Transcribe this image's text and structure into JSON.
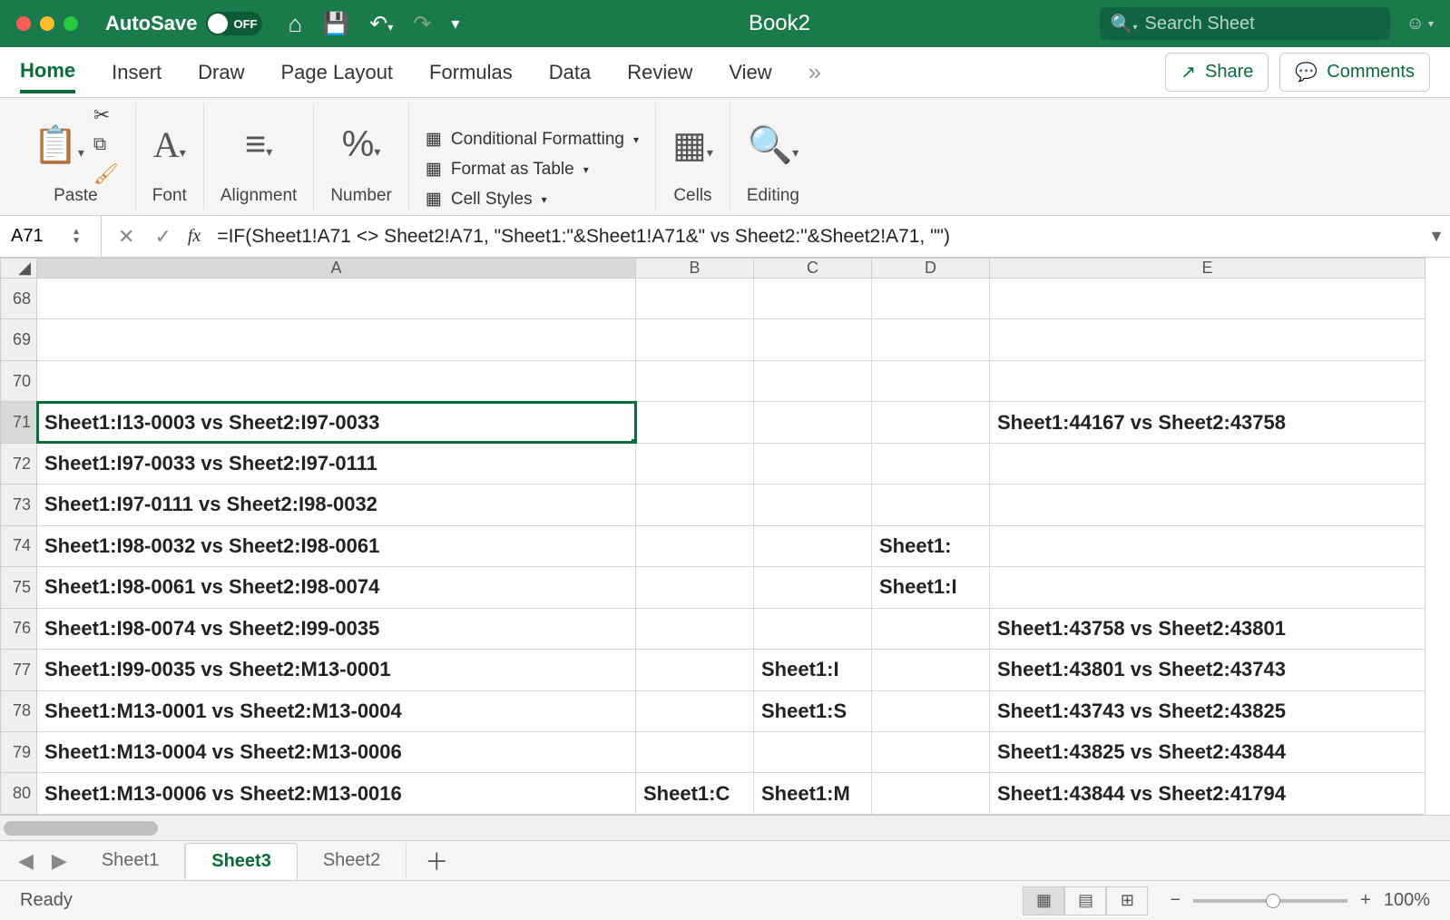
{
  "titlebar": {
    "autosave_label": "AutoSave",
    "autosave_state": "OFF",
    "doc_title": "Book2",
    "search_placeholder": "Search Sheet"
  },
  "ribbon_tabs": {
    "items": [
      "Home",
      "Insert",
      "Draw",
      "Page Layout",
      "Formulas",
      "Data",
      "Review",
      "View"
    ],
    "active": "Home",
    "share": "Share",
    "comments": "Comments"
  },
  "ribbon_groups": {
    "paste": "Paste",
    "font": "Font",
    "alignment": "Alignment",
    "number": "Number",
    "cond_fmt": "Conditional Formatting",
    "fmt_table": "Format as Table",
    "cell_styles": "Cell Styles",
    "cells": "Cells",
    "editing": "Editing"
  },
  "formula_bar": {
    "name_box": "A71",
    "formula": "=IF(Sheet1!A71 <> Sheet2!A71, \"Sheet1:\"&Sheet1!A71&\" vs Sheet2:\"&Sheet2!A71, \"\")"
  },
  "columns": [
    "A",
    "B",
    "C",
    "D",
    "E"
  ],
  "rows": [
    {
      "n": 68,
      "A": "",
      "B": "",
      "C": "",
      "D": "",
      "E": ""
    },
    {
      "n": 69,
      "A": "",
      "B": "",
      "C": "",
      "D": "",
      "E": ""
    },
    {
      "n": 70,
      "A": "",
      "B": "",
      "C": "",
      "D": "",
      "E": ""
    },
    {
      "n": 71,
      "A": "Sheet1:I13-0003 vs Sheet2:I97-0033",
      "B": "",
      "C": "",
      "D": "",
      "E": "Sheet1:44167 vs Sheet2:43758"
    },
    {
      "n": 72,
      "A": "Sheet1:I97-0033 vs Sheet2:I97-0111",
      "B": "",
      "C": "",
      "D": "",
      "E": ""
    },
    {
      "n": 73,
      "A": "Sheet1:I97-0111 vs Sheet2:I98-0032",
      "B": "",
      "C": "",
      "D": "",
      "E": ""
    },
    {
      "n": 74,
      "A": "Sheet1:I98-0032 vs Sheet2:I98-0061",
      "B": "",
      "C": "",
      "D": "Sheet1:",
      "E": ""
    },
    {
      "n": 75,
      "A": "Sheet1:I98-0061 vs Sheet2:I98-0074",
      "B": "",
      "C": "",
      "D": "Sheet1:I",
      "E": ""
    },
    {
      "n": 76,
      "A": "Sheet1:I98-0074 vs Sheet2:I99-0035",
      "B": "",
      "C": "",
      "D": "",
      "E": "Sheet1:43758 vs Sheet2:43801"
    },
    {
      "n": 77,
      "A": "Sheet1:I99-0035 vs Sheet2:M13-0001",
      "B": "",
      "C": "Sheet1:I",
      "D": "",
      "E": "Sheet1:43801 vs Sheet2:43743"
    },
    {
      "n": 78,
      "A": "Sheet1:M13-0001 vs Sheet2:M13-0004",
      "B": "",
      "C": "Sheet1:S",
      "D": "",
      "E": "Sheet1:43743 vs Sheet2:43825"
    },
    {
      "n": 79,
      "A": "Sheet1:M13-0004 vs Sheet2:M13-0006",
      "B": "",
      "C": "",
      "D": "",
      "E": "Sheet1:43825 vs Sheet2:43844"
    },
    {
      "n": 80,
      "A": "Sheet1:M13-0006 vs Sheet2:M13-0016",
      "B": "Sheet1:C",
      "C": "Sheet1:M",
      "D": "",
      "E": "Sheet1:43844 vs Sheet2:41794"
    }
  ],
  "selected_cell": {
    "row": 71,
    "col": "A"
  },
  "sheet_tabs": {
    "items": [
      "Sheet1",
      "Sheet3",
      "Sheet2"
    ],
    "active": "Sheet3"
  },
  "statusbar": {
    "status": "Ready",
    "zoom": "100%"
  }
}
